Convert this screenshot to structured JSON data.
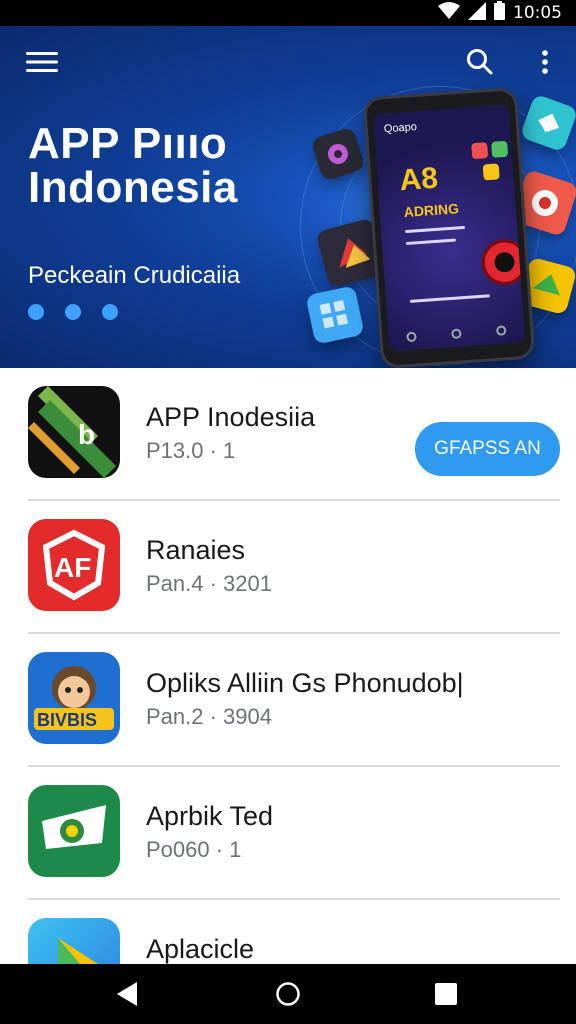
{
  "status_bar": {
    "time": "10:05"
  },
  "header": {
    "menu_icon": "menu-icon",
    "search_icon": "search-icon",
    "more_icon": "more-vert-icon"
  },
  "hero": {
    "title_line1": "APP Pıııo",
    "title_line2": "Indonesia",
    "subtitle": "Peckeain Crudicaiia",
    "dot_count": 3,
    "phone": {
      "header": "Qoapo",
      "big": "A8",
      "small": "ADRING"
    }
  },
  "apps": [
    {
      "name": "APP Inodesiia",
      "meta": "P13.0 · 1",
      "icon": "app-icon-dark-green-stripe",
      "button": "GFAPSS AN"
    },
    {
      "name": "Ranaies",
      "meta": "Pan.4 · 3201",
      "icon": "app-icon-red-badge"
    },
    {
      "name": "Opliks Alliin Gs Phonudob|",
      "meta": "Pan.2 · 3904",
      "icon": "app-icon-cartoon"
    },
    {
      "name": "Aprbik Ted",
      "meta": "Po060 · 1",
      "icon": "app-icon-green-leaf"
    },
    {
      "name": "Aplacicle",
      "meta": "",
      "icon": "app-icon-blue-play"
    }
  ],
  "nav": {
    "back_icon": "back-icon",
    "home_icon": "home-icon",
    "recents_icon": "recents-icon"
  },
  "colors": {
    "accent": "#2e9bf0",
    "hero_dark": "#0a2a6e",
    "hero_mid": "#1e63d6",
    "dot": "#3fa0ff"
  }
}
